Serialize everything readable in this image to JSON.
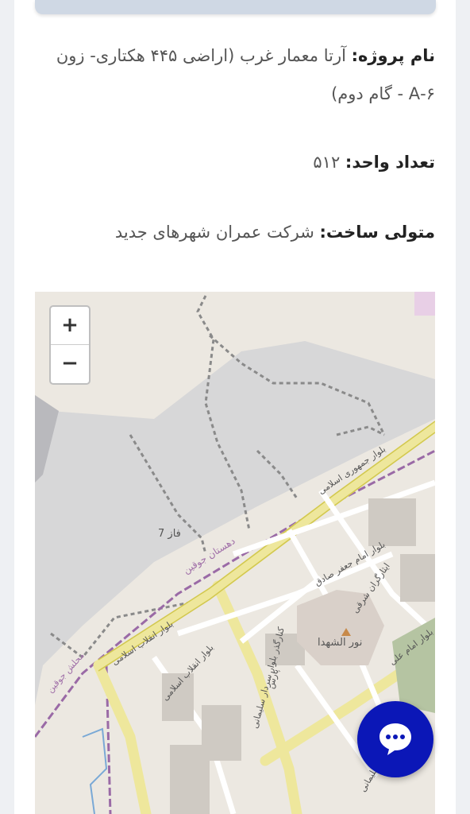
{
  "project": {
    "name_label": "نام پروژه:",
    "name_value": "آرتا معمار غرب (اراضی ۴۴۵ هکتاری- زون ۶-A - گام دوم)",
    "units_label": "تعداد واحد:",
    "units_value": "۵۱۲",
    "builder_label": "متولی ساخت:",
    "builder_value": "شرکت عمران شهرهای جدید"
  },
  "map": {
    "zoom_in": "+",
    "zoom_out": "−",
    "labels": {
      "phase": "فاز 7",
      "district": "دهستان جوقین",
      "landmark": "نور الشهدا",
      "boulevard_jomhouri": "بلوار جمهوری اسلامی",
      "boulevard_enghelab": "بلوار انقلاب اسلامی",
      "boulevard_enghelab2": "بلوار انقلاب اسلامی",
      "boulevard_jafar": "بلوار امام جعفر صادق",
      "street_ithargaran": "ایثارگران شرقی",
      "boulevard_soleimani": "کنارگذر بلوار سردار سلیمانی",
      "street_pars": "پارس",
      "boulevard_ali": "بلوار امام علی",
      "area_joghin": "محلش جوقین",
      "street_soleimani_short": "سلیمانی"
    }
  },
  "chat": {
    "icon": "chat-bubble-icon"
  }
}
